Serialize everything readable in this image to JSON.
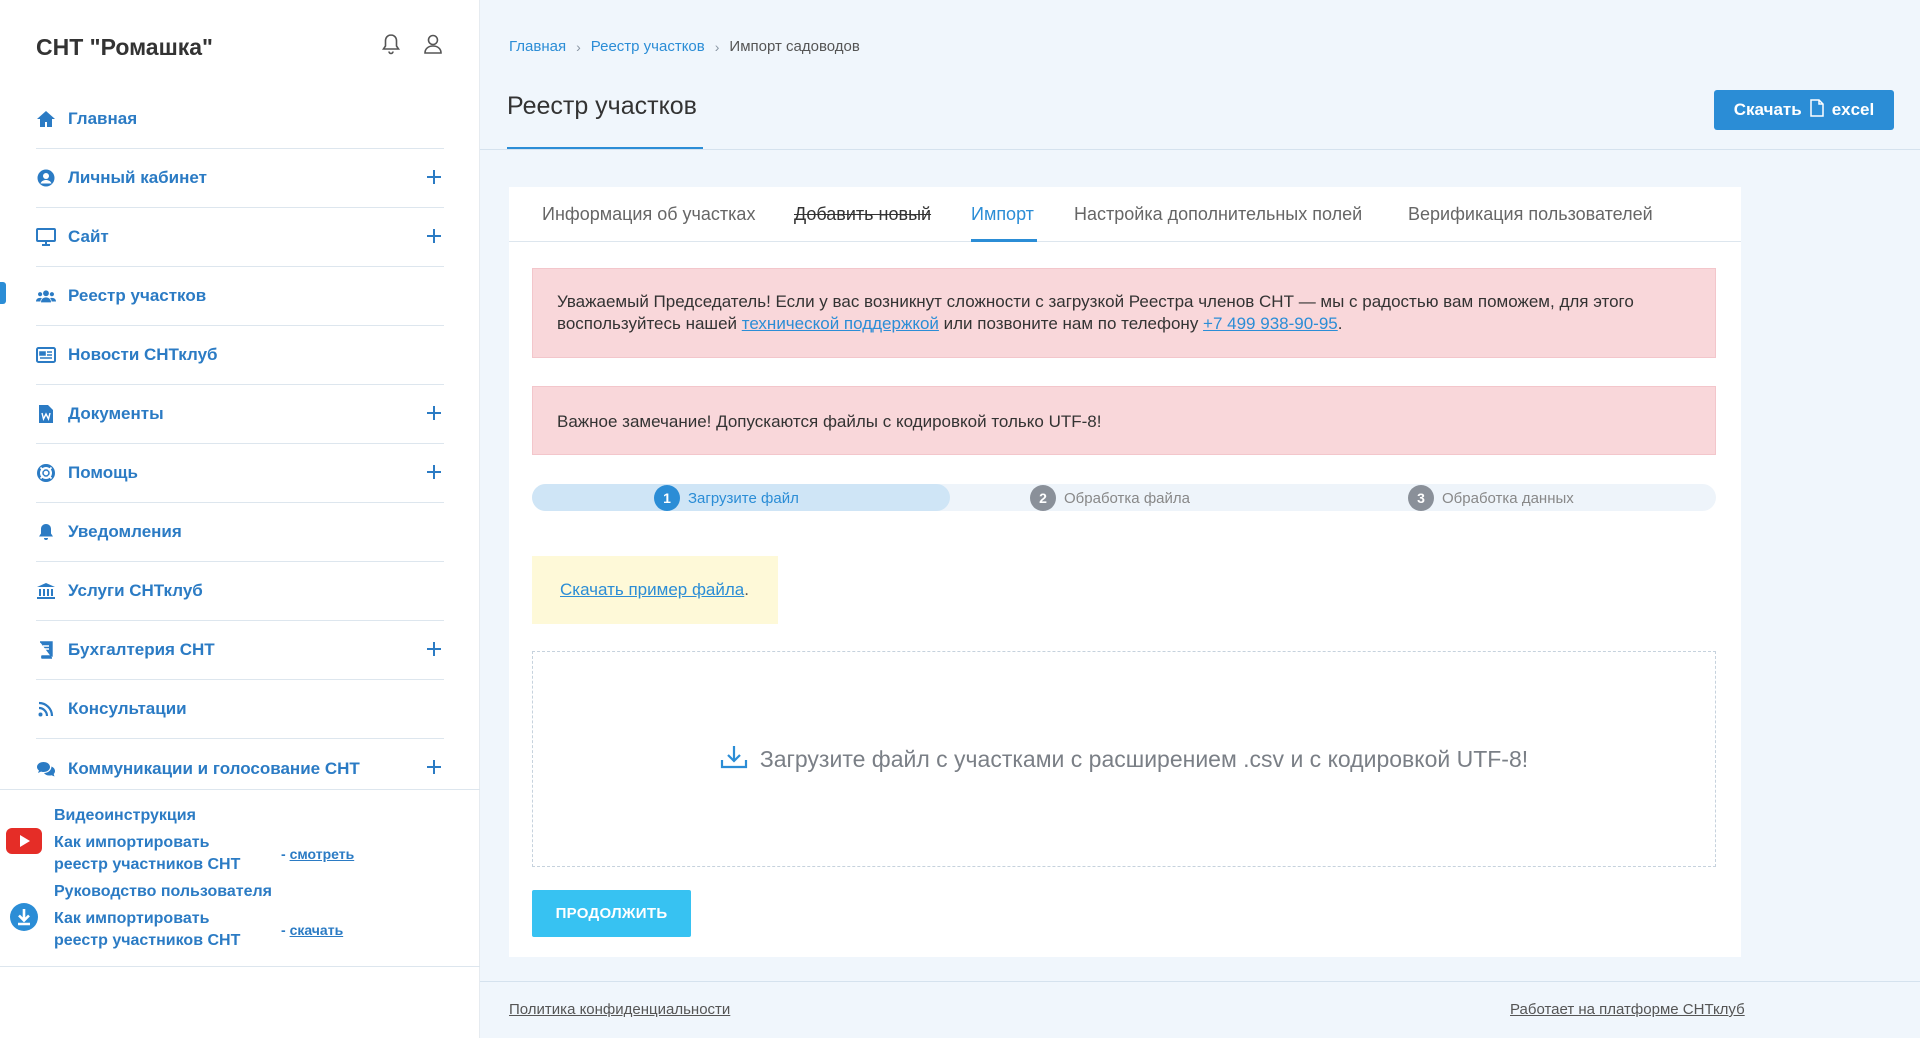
{
  "brand": "СНТ \"Ромашка\"",
  "sidebar": {
    "items": [
      {
        "label": "Главная",
        "icon": "home-icon",
        "expandable": false
      },
      {
        "label": "Личный кабинет",
        "icon": "user-circle-icon",
        "expandable": true
      },
      {
        "label": "Сайт",
        "icon": "monitor-icon",
        "expandable": true
      },
      {
        "label": "Реестр участков",
        "icon": "users-icon",
        "expandable": false,
        "active": true
      },
      {
        "label": "Новости СНТклуб",
        "icon": "newspaper-icon",
        "expandable": false
      },
      {
        "label": "Документы",
        "icon": "word-document-icon",
        "expandable": true
      },
      {
        "label": "Помощь",
        "icon": "lifebuoy-icon",
        "expandable": true
      },
      {
        "label": "Уведомления",
        "icon": "bell-icon",
        "expandable": false
      },
      {
        "label": "Услуги СНТклуб",
        "icon": "bank-icon",
        "expandable": false
      },
      {
        "label": "Бухгалтерия СНТ",
        "icon": "book-icon",
        "expandable": true
      },
      {
        "label": "Консультации",
        "icon": "rss-icon",
        "expandable": false
      },
      {
        "label": "Коммуникации и голосование СНТ",
        "icon": "comments-icon",
        "expandable": true
      }
    ],
    "video": {
      "title": "Видеоинструкция",
      "subtitle": "Как импортировать реестр участников СНТ",
      "link_prefix": "- ",
      "link": "смотреть"
    },
    "manual": {
      "title": "Руководство пользователя",
      "subtitle": "Как импортировать реестр участников СНТ",
      "link_prefix": "- ",
      "link": "скачать"
    }
  },
  "breadcrumb": {
    "home": "Главная",
    "registry": "Реестр участков",
    "current": "Импорт садоводов"
  },
  "page_title": "Реестр участков",
  "download_button": {
    "label": "Скачать",
    "suffix": "excel"
  },
  "tabs": [
    {
      "label": "Информация об участках"
    },
    {
      "label": "Добавить новый"
    },
    {
      "label": "Импорт",
      "active": true
    },
    {
      "label": "Настройка дополнительных полей"
    },
    {
      "label": "Верификация пользователей"
    }
  ],
  "alert1": {
    "text_before": "Уважаемый Председатель! Если у вас возникнут сложности с загрузкой Реестра членов СНТ — мы с радостью вам поможем, для этого воспользуйтесь нашей ",
    "support_link": "технической поддержкой",
    "text_middle": " или позвоните нам по телефону ",
    "phone": "+7 499 938-90-95",
    "text_after": "."
  },
  "alert2": {
    "text": "Важное замечание! Допускаются файлы с кодировкой только UTF-8!"
  },
  "steps": [
    {
      "num": "1",
      "label": "Загрузите файл",
      "active": true
    },
    {
      "num": "2",
      "label": "Обработка файла",
      "active": false
    },
    {
      "num": "3",
      "label": "Обработка данных",
      "active": false
    }
  ],
  "sample": {
    "link": "Скачать пример файла",
    "suffix": "."
  },
  "dropzone": {
    "text": "Загрузите файл с участками с расширением .csv и с кодировкой UTF-8!"
  },
  "continue_button": "ПРОДОЛЖИТЬ",
  "footer": {
    "privacy": "Политика конфиденциальности",
    "platform": "Работает на платформе СНТклуб"
  },
  "colors": {
    "accent": "#2b8dd6",
    "alert_bg": "#f9d7da",
    "sample_bg": "#fef9d8",
    "continue_btn": "#37c2f2",
    "youtube_red": "#e52d27"
  }
}
